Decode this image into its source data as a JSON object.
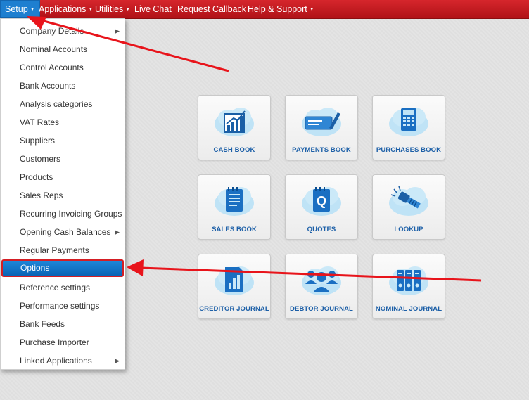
{
  "nav": {
    "items": [
      {
        "label": "Setup",
        "caret": true
      },
      {
        "label": "Applications",
        "caret": true
      },
      {
        "label": "Utilities",
        "caret": true
      },
      {
        "label": "Live Chat",
        "caret": false
      },
      {
        "label": "Request Callback",
        "caret": false
      },
      {
        "label": "Help & Support",
        "caret": true
      }
    ]
  },
  "menu": {
    "items": [
      {
        "label": "Company Details",
        "submenu": true
      },
      {
        "label": "Nominal Accounts",
        "submenu": false
      },
      {
        "label": "Control Accounts",
        "submenu": false
      },
      {
        "label": "Bank Accounts",
        "submenu": false
      },
      {
        "label": "Analysis categories",
        "submenu": false
      },
      {
        "label": "VAT Rates",
        "submenu": false
      },
      {
        "label": "Suppliers",
        "submenu": false
      },
      {
        "label": "Customers",
        "submenu": false
      },
      {
        "label": "Products",
        "submenu": false
      },
      {
        "label": "Sales Reps",
        "submenu": false
      },
      {
        "label": "Recurring Invoicing Groups",
        "submenu": false
      },
      {
        "label": "Opening Cash Balances",
        "submenu": true
      },
      {
        "label": "Regular Payments",
        "submenu": false
      },
      {
        "label": "Options",
        "submenu": false,
        "active": true
      },
      {
        "label": "Reference settings",
        "submenu": false
      },
      {
        "label": "Performance settings",
        "submenu": false
      },
      {
        "label": "Bank Feeds",
        "submenu": false
      },
      {
        "label": "Purchase Importer",
        "submenu": false
      },
      {
        "label": "Linked Applications",
        "submenu": true
      }
    ]
  },
  "tiles": [
    {
      "label": "CASH BOOK",
      "icon": "bar-chart-icon"
    },
    {
      "label": "PAYMENTS BOOK",
      "icon": "cheque-pen-icon"
    },
    {
      "label": "PURCHASES BOOK",
      "icon": "calculator-icon"
    },
    {
      "label": "SALES BOOK",
      "icon": "notepad-icon"
    },
    {
      "label": "QUOTES",
      "icon": "quote-notepad-icon"
    },
    {
      "label": "LOOKUP",
      "icon": "flashlight-icon"
    },
    {
      "label": "CREDITOR JOURNAL",
      "icon": "document-chart-icon"
    },
    {
      "label": "DEBTOR JOURNAL",
      "icon": "people-icon"
    },
    {
      "label": "NOMINAL JOURNAL",
      "icon": "binders-icon"
    }
  ],
  "colors": {
    "nav_red": "#c41c21",
    "accent_blue": "#1e7fd0",
    "tile_label": "#1c5fa7",
    "annotation_arrow": "#e8141b"
  }
}
